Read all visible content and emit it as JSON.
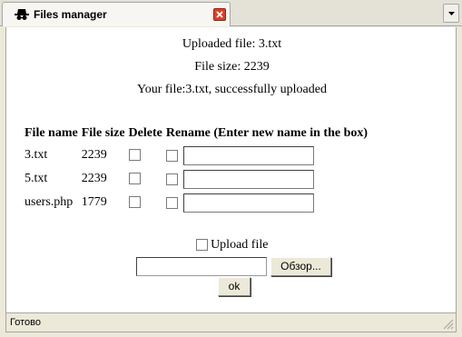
{
  "window": {
    "tab_title": "Files manager",
    "status": "Готово"
  },
  "messages": {
    "uploaded_file": "Uploaded file: 3.txt",
    "file_size": "File size: 2239",
    "success": "Your file:3.txt, successfully uploaded"
  },
  "table": {
    "headers": [
      "File name",
      "File size",
      "Delete",
      "Rename (Enter new name in the box)"
    ],
    "rows": [
      {
        "name": "3.txt",
        "size": "2239",
        "delete_checked": false,
        "rename_checked": false,
        "rename_value": ""
      },
      {
        "name": "5.txt",
        "size": "2239",
        "delete_checked": false,
        "rename_checked": false,
        "rename_value": ""
      },
      {
        "name": "users.php",
        "size": "1779",
        "delete_checked": false,
        "rename_checked": false,
        "rename_value": ""
      }
    ]
  },
  "upload": {
    "checkbox_label": "Upload file",
    "file_path_value": "",
    "browse_label": "Обзор...",
    "ok_label": "ok"
  },
  "colors": {
    "chrome": "#ece9d8",
    "close_button": "#d9412b"
  },
  "icons": {
    "tab": "spy-icon",
    "close": "close-icon",
    "menu": "chevron-down-icon",
    "resize": "resize-grip-icon"
  }
}
